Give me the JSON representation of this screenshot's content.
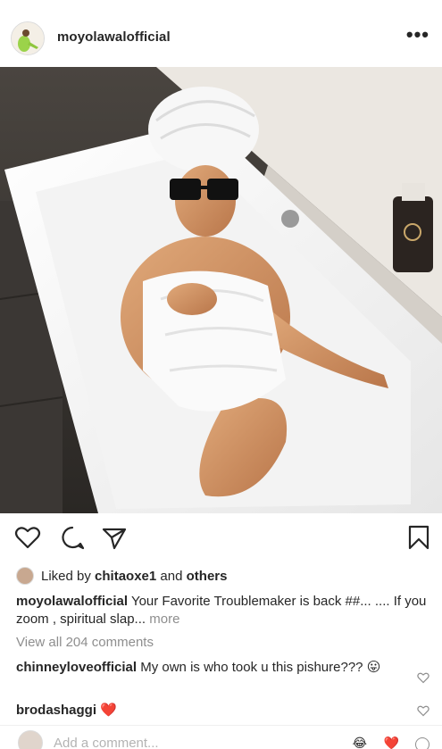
{
  "post": {
    "username": "moyolawalofficial",
    "more_label": "•••"
  },
  "icons": {
    "like": "heart-outline-icon",
    "comment": "comment-bubble-icon",
    "share": "paper-plane-icon",
    "save": "bookmark-icon",
    "more": "more-dots-icon"
  },
  "likes": {
    "prefix": "Liked by",
    "user": "chitaoxe1",
    "and": "and",
    "others": "others"
  },
  "caption": {
    "user": "moyolawalofficial",
    "text": "Your Favorite Troublemaker is back ##... .... If you zoom , spiritual slap...",
    "more": "more"
  },
  "view_all": "View all 204 comments",
  "comments": [
    {
      "user": "chinneyloveofficial",
      "text": "My own is who took u this pishure???",
      "emoji": "😛"
    },
    {
      "user": "brodashaggi",
      "text": "",
      "emoji": "❤️"
    }
  ],
  "add_comment": {
    "placeholder": "Add a comment...",
    "emoji_1": "😂",
    "emoji_2": "❤️"
  },
  "colors": {
    "text": "#262626",
    "muted": "#8e8e8e",
    "heart_red": "#ed4956"
  }
}
